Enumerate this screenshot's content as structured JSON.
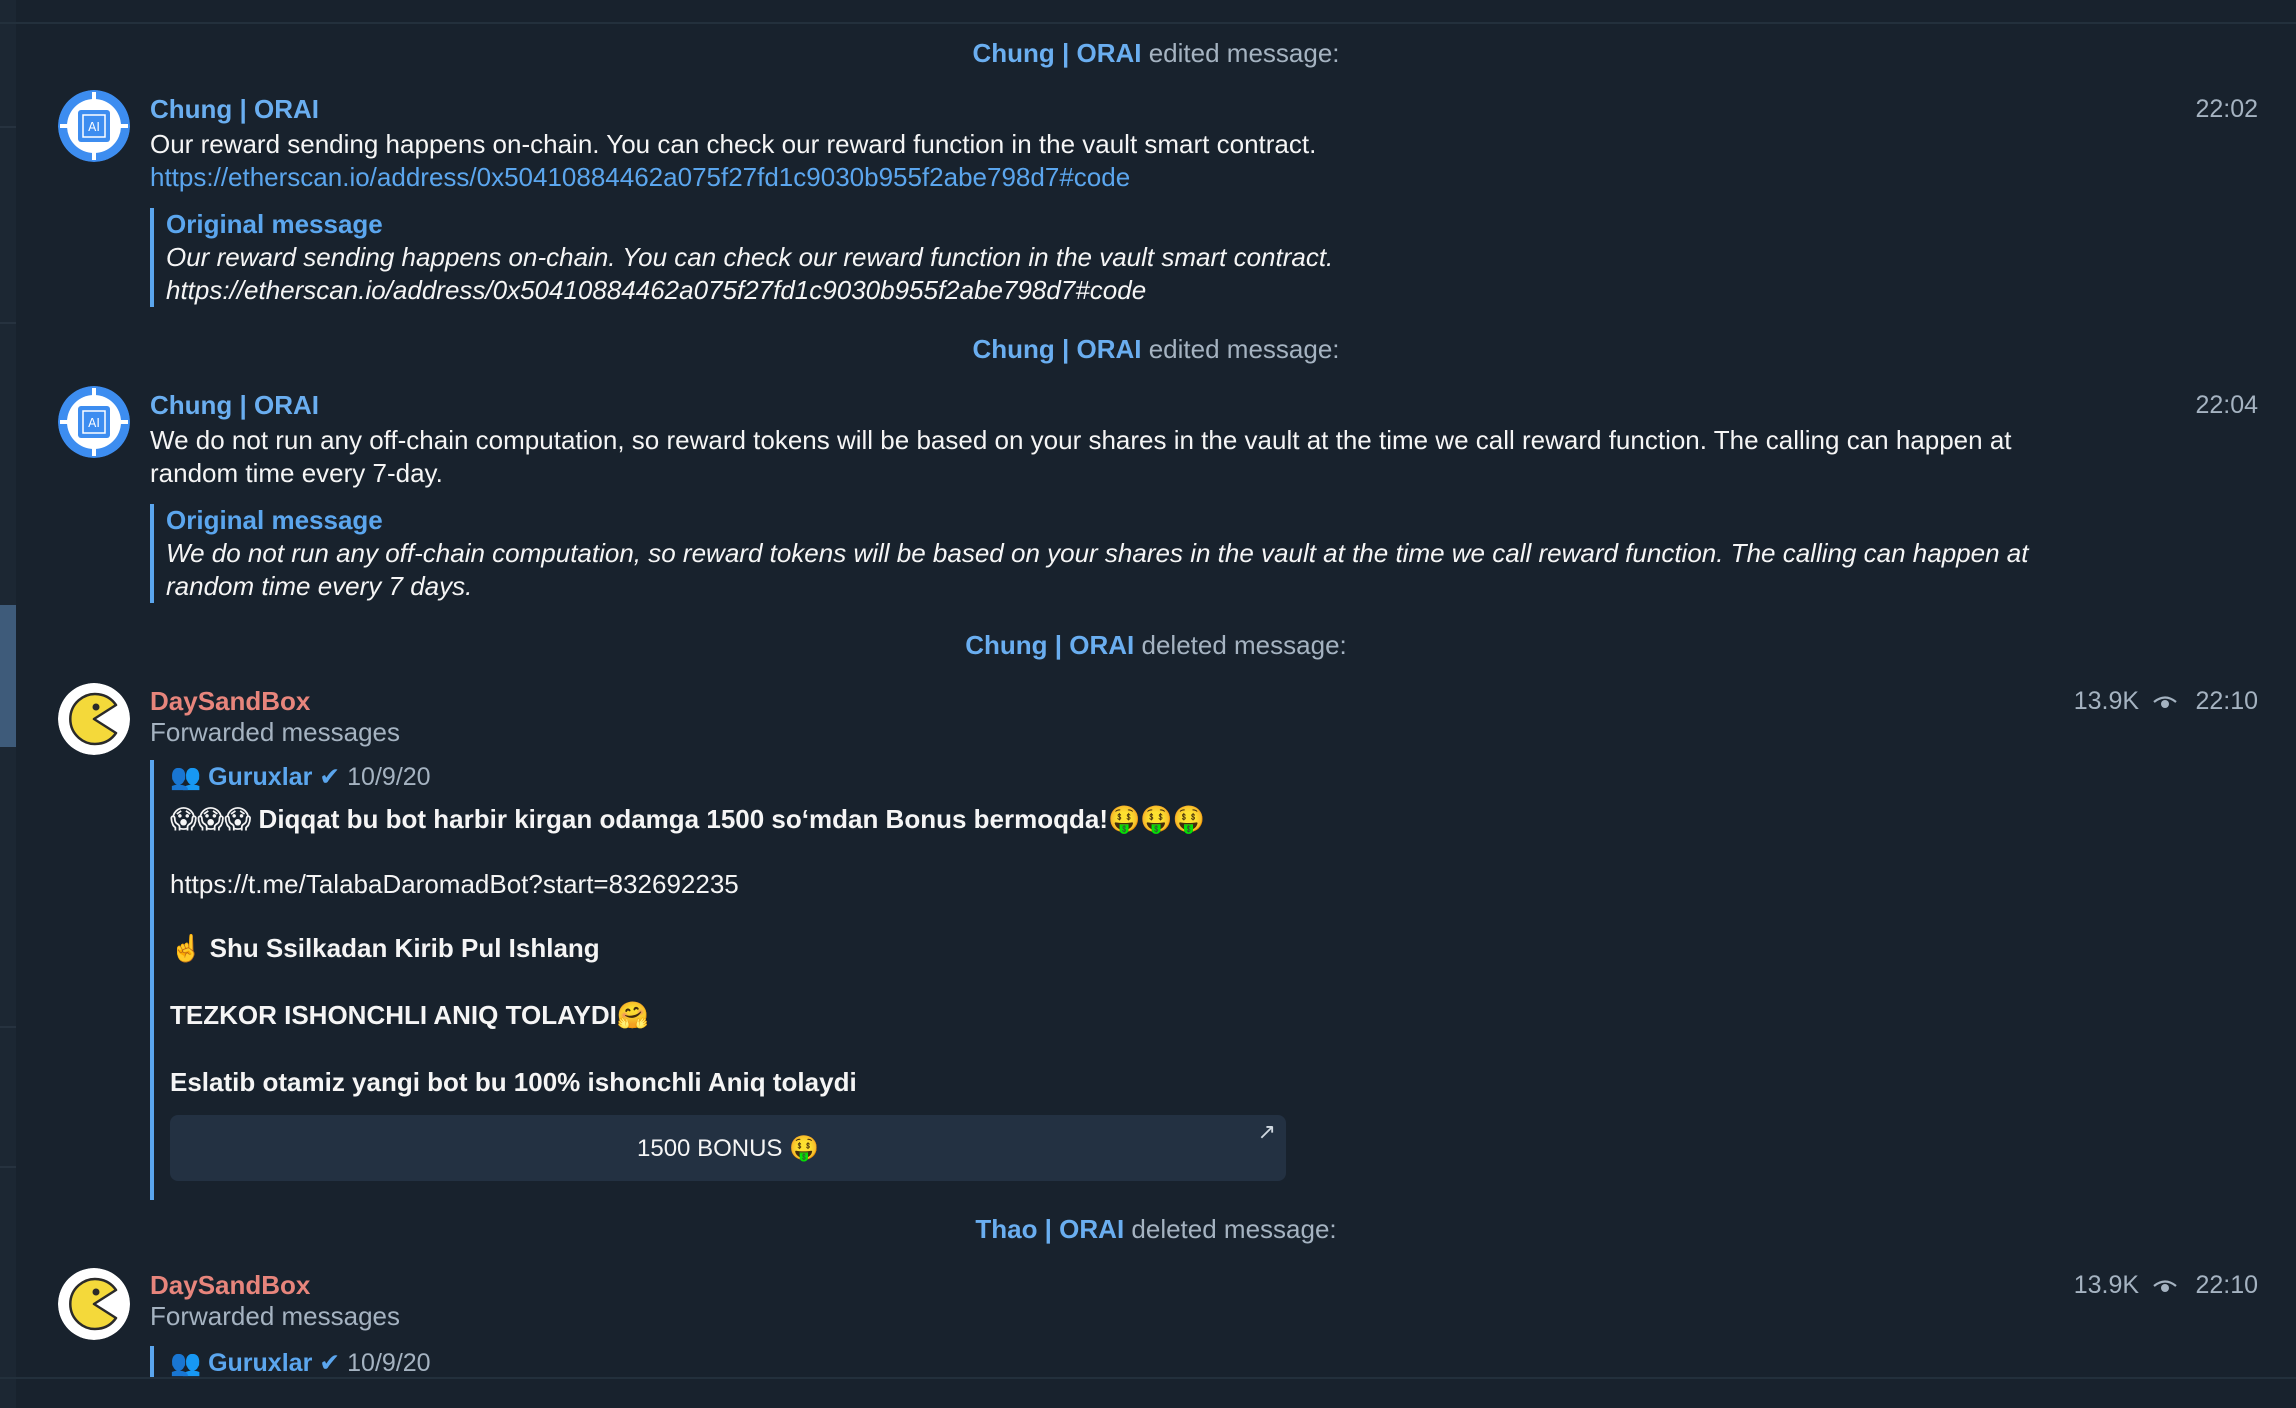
{
  "events": [
    {
      "service": {
        "actor": "Chung | ORAI",
        "action": " edited message:"
      },
      "message": {
        "sender": "Chung | ORAI",
        "time": "22:02",
        "text": "Our reward sending happens on-chain. You can check our reward function in the vault smart contract.",
        "link": "https://etherscan.io/address/0x50410884462a075f27fd1c9030b955f2abe798d7#code",
        "original_title": "Original message",
        "original_line1": "Our reward sending happens on-chain. You can check our reward function in the vault smart contract.",
        "original_line2": "https://etherscan.io/address/0x50410884462a075f27fd1c9030b955f2abe798d7#code"
      }
    },
    {
      "service": {
        "actor": "Chung | ORAI",
        "action": " edited message:"
      },
      "message": {
        "sender": "Chung | ORAI",
        "time": "22:04",
        "text_line1": "We do not run any off-chain computation, so reward tokens will be based on your shares in the vault at the time we call reward function. The calling can happen at",
        "text_line2": "random time every 7-day.",
        "original_title": "Original message",
        "original_line1": "We do not run any off-chain computation, so reward tokens will be based on your shares in the vault at the time we call reward function. The calling can happen at",
        "original_line2": "random time every 7 days."
      }
    },
    {
      "service": {
        "actor": "Chung | ORAI",
        "action": " deleted message:"
      },
      "message": {
        "sender": "DaySandBox",
        "views": "13.9K",
        "time": "22:10",
        "subtitle": "Forwarded messages",
        "forward": {
          "group_icon": "👥",
          "group": "Guruxlar",
          "check": "✔",
          "date": "10/9/20",
          "line1_emoji": "😱😱😱",
          "line1": " Diqqat bu bot harbir kirgan odamga 1500 so‘mdan Bonus bermoqda!",
          "line1_tail": "🤑🤑🤑",
          "link": "https://t.me/TalabaDaromadBot?start=832692235",
          "line3_emoji": "☝️",
          "line3": " Shu Ssilkadan Kirib Pul Ishlang",
          "line4": "TEZKOR ISHONCHLI ANIQ TOLAYDI",
          "line4_emoji": "🤗",
          "line5": "Eslatib otamiz yangi bot bu 100% ishonchli Aniq tolaydi",
          "button_label": "1500 BONUS",
          "button_emoji": "🤑",
          "button_arrow": "↗"
        }
      }
    },
    {
      "service": {
        "actor": "Thao | ORAI",
        "action": " deleted message:"
      },
      "message": {
        "sender": "DaySandBox",
        "views": "13.9K",
        "time": "22:10",
        "subtitle": "Forwarded messages",
        "forward": {
          "group_icon": "👥",
          "group": "Guruxlar",
          "check": "✔",
          "date": "10/9/20"
        }
      }
    }
  ],
  "icons": {
    "orai_avatar": "orai-chip-avatar-icon",
    "daysandbox_avatar": "pacman-avatar-icon",
    "views": "eye-icon"
  },
  "colors": {
    "background": "#18222d",
    "accent": "#5ba6ee",
    "sender_pink": "#e7857c",
    "muted": "#a5b3c1"
  }
}
